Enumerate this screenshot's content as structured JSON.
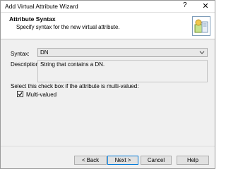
{
  "window": {
    "title": "Add Virtual Attribute Wizard",
    "help_glyph": "?",
    "close_glyph": "✕"
  },
  "header": {
    "title": "Attribute Syntax",
    "subtitle": "Specify syntax for the new virtual attribute."
  },
  "form": {
    "syntax_label": "Syntax:",
    "syntax_value": "DN",
    "description_label": "Description:",
    "description_value": "String that contains a DN.",
    "multi_prompt": "Select this check box if the attribute is multi-valued:",
    "multi_label": "Multi-valued",
    "multi_checked": true
  },
  "buttons": {
    "back": "< Back",
    "next": "Next >",
    "cancel": "Cancel",
    "help": "Help"
  },
  "icons": {
    "header": "wizard-document-icon",
    "dropdown": "chevron-down-icon"
  }
}
